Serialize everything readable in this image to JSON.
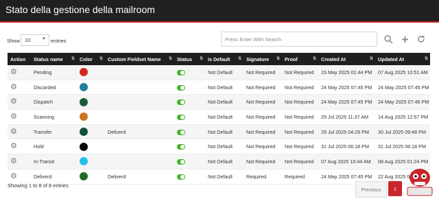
{
  "header": {
    "title": "Stato della gestione della mailroom"
  },
  "controls": {
    "show_label": "Show",
    "entries_value": "10",
    "entries_label": "entries",
    "search_placeholder": "Press Enter With Search"
  },
  "table": {
    "columns": [
      "Action",
      "Status name",
      "Color",
      "Custom Fieldset Name",
      "Status",
      "Is Default",
      "Signature",
      "Proof",
      "Created At",
      "Updated At"
    ],
    "rows": [
      {
        "name": "Pending",
        "color": "#d42a1c",
        "fieldset": "",
        "is_default": "Not Default",
        "signature": "Not Required",
        "proof": "Not Required",
        "created": "15 May 2025 01:44 PM",
        "updated": "07 Aug 2025 10:51 AM"
      },
      {
        "name": "Discarded",
        "color": "#1e7fa0",
        "fieldset": "",
        "is_default": "Not Default",
        "signature": "Not Required",
        "proof": "Not Required",
        "created": "24 May 2025 07:45 PM",
        "updated": "24 May 2025 07:45 PM"
      },
      {
        "name": "Dispatch",
        "color": "#1a5c3a",
        "fieldset": "",
        "is_default": "Not Default",
        "signature": "Not Required",
        "proof": "Not Required",
        "created": "24 May 2025 07:45 PM",
        "updated": "24 May 2025 07:46 PM"
      },
      {
        "name": "Scanning",
        "color": "#c9761c",
        "fieldset": "",
        "is_default": "Not Default",
        "signature": "Not Required",
        "proof": "Not Required",
        "created": "29 Jul 2025 11:37 AM",
        "updated": "14 Aug 2025 12:57 PM"
      },
      {
        "name": "Transfer",
        "color": "#145239",
        "fieldset": "Deliverd",
        "is_default": "Not Default",
        "signature": "Not Required",
        "proof": "Not Required",
        "created": "29 Jul 2025 04:29 PM",
        "updated": "30 Jul 2025 09:48 PM"
      },
      {
        "name": "Hold",
        "color": "#0a0a0a",
        "fieldset": "",
        "is_default": "Not Default",
        "signature": "Not Required",
        "proof": "Not Required",
        "created": "31 Jul 2025 06:18 PM",
        "updated": "31 Jul 2025 06:18 PM"
      },
      {
        "name": "In-Transit",
        "color": "#22c0ec",
        "fieldset": "",
        "is_default": "Not Default",
        "signature": "Not Required",
        "proof": "Not Required",
        "created": "07 Aug 2025 10:44 AM",
        "updated": "08 Aug 2025 01:24 PM"
      },
      {
        "name": "Deliverd",
        "color": "#1e6b25",
        "fieldset": "Deliverd",
        "is_default": "Not Default",
        "signature": "Required",
        "proof": "Required",
        "created": "24 May 2025 07:45 PM",
        "updated": "22 Aug 2025 03:06 PM"
      }
    ]
  },
  "footer": {
    "info": "Showing 1 to 8 of 8 entries",
    "previous_label": "Previous",
    "current_page": "1"
  },
  "colors": {
    "accent": "#c9252b",
    "header_bg": "#202020",
    "toggle_on": "#3fb52a"
  },
  "icons": {
    "action": "gear-icon",
    "search": "search-icon",
    "add": "plus-icon",
    "refresh": "refresh-icon"
  }
}
